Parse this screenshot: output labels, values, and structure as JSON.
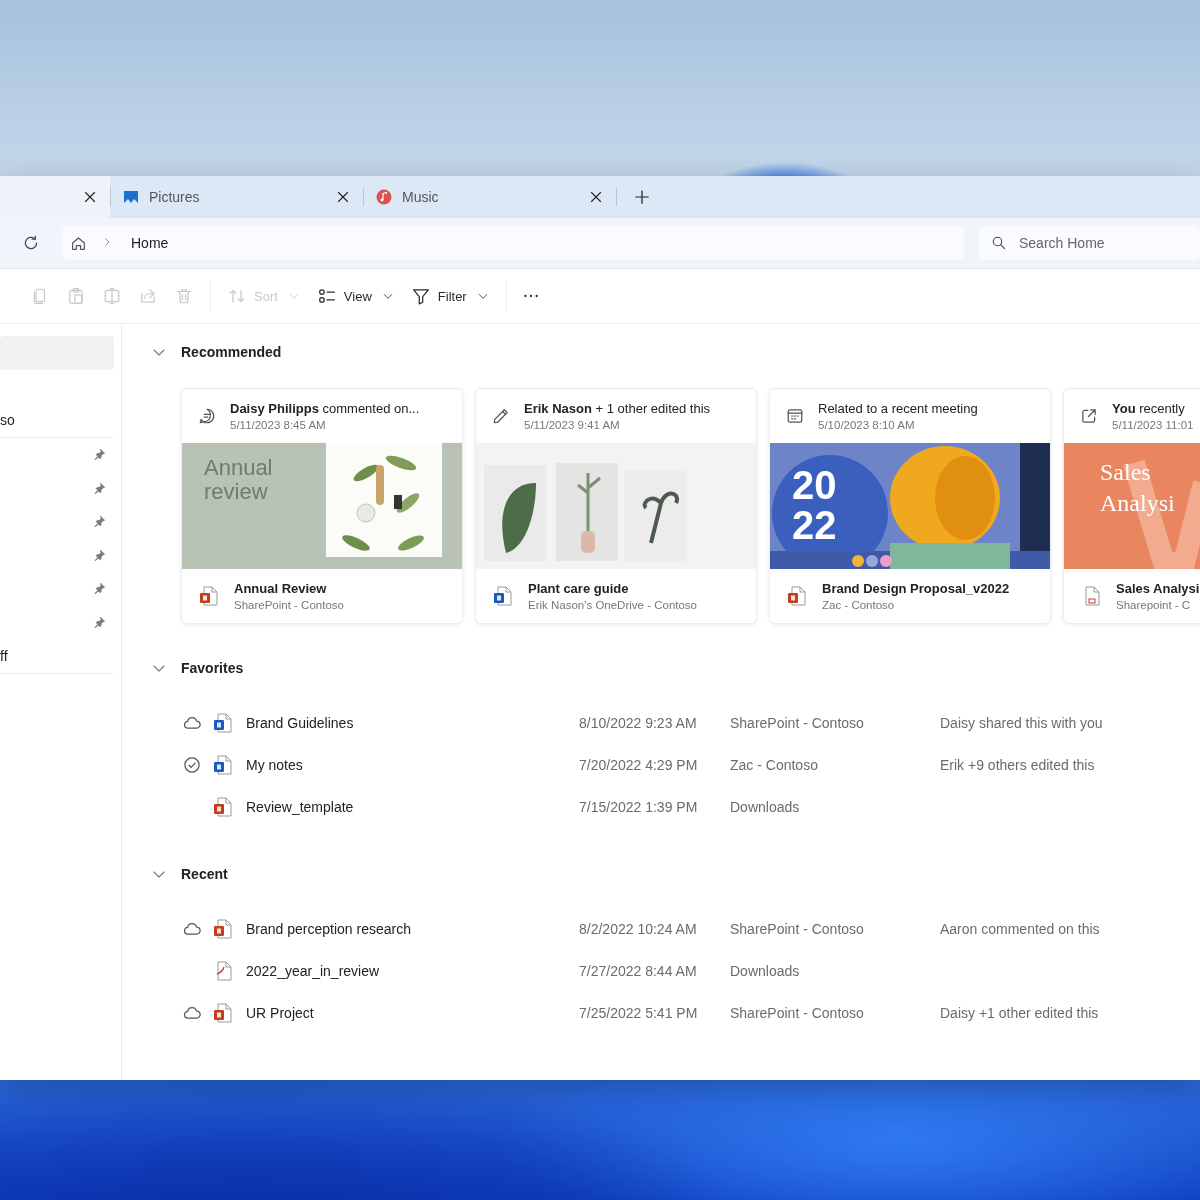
{
  "tabs": [
    {
      "selected": true
    },
    {
      "title": "Pictures",
      "selected": false
    },
    {
      "title": "Music",
      "selected": false
    }
  ],
  "address": {
    "breadcrumb": "Home"
  },
  "search": {
    "placeholder": "Search Home"
  },
  "toolbar": [
    {
      "kind": "icon",
      "disabled": true
    },
    {
      "kind": "icon",
      "disabled": true
    },
    {
      "kind": "icon",
      "disabled": true
    },
    {
      "kind": "icon",
      "disabled": true
    },
    {
      "kind": "icon",
      "disabled": true
    },
    {
      "kind": "menu",
      "label": "Sort",
      "disabled": true
    },
    {
      "kind": "menu",
      "label": "View",
      "disabled": false
    },
    {
      "kind": "menu",
      "label": "Filter",
      "disabled": false
    },
    {
      "kind": "icon",
      "disabled": false
    }
  ],
  "sidebar": {
    "groups": [
      {
        "items": [
          {
            "selected": true,
            "pinned": false
          },
          {
            "label": "so",
            "selected": false,
            "pinned": false
          }
        ]
      },
      {
        "items": [
          {
            "selected": false,
            "pinned": true
          },
          {
            "selected": false,
            "pinned": true
          },
          {
            "selected": false,
            "pinned": true
          },
          {
            "selected": false,
            "pinned": true
          },
          {
            "selected": false,
            "pinned": true
          },
          {
            "selected": false,
            "pinned": true
          },
          {
            "label": "ff",
            "selected": false,
            "pinned": false
          }
        ]
      }
    ]
  },
  "sections": [
    {
      "kind": "cards",
      "title": "Recommended",
      "expanded": true,
      "cards": [
        {
          "activity": "**Daisy Philipps** commented on...",
          "time": "5/11/2023 8:45 AM",
          "thumbnail_text": [
            "Annual",
            "review"
          ],
          "name": "Annual Review",
          "location": "SharePoint - Contoso"
        },
        {
          "activity": "**Erik Nason** + 1 other edited this",
          "time": "5/11/2023 9:41 AM",
          "name": "Plant care guide",
          "location": "Erik Nason's OneDrive - Contoso"
        },
        {
          "activity": "Related to a recent meeting",
          "time": "5/10/2023 8:10 AM",
          "thumbnail_text": [
            "20",
            "22"
          ],
          "name": "Brand Design Proposal_v2022",
          "location": "Zac - Contoso"
        },
        {
          "activity": "**You** recently",
          "time": "5/11/2023 11:01",
          "thumbnail_text": [
            "Sales",
            "Analysi"
          ],
          "name": "Sales Analysi",
          "location": "Sharepoint - C"
        }
      ]
    },
    {
      "kind": "list",
      "title": "Favorites",
      "expanded": true,
      "rows": [
        {
          "kind": "word",
          "cloud": true,
          "synced": false,
          "name": "Brand Guidelines",
          "date": "8/10/2022 9:23 AM",
          "location": "SharePoint - Contoso",
          "activity": "Daisy shared this with you"
        },
        {
          "kind": "word",
          "cloud": false,
          "synced": true,
          "name": "My notes",
          "date": "7/20/2022 4:29 PM",
          "location": "Zac - Contoso",
          "activity": "Erik +9 others edited this"
        },
        {
          "kind": "ppt",
          "cloud": false,
          "synced": false,
          "name": "Review_template",
          "date": "7/15/2022 1:39 PM",
          "location": "Downloads"
        }
      ]
    },
    {
      "kind": "list",
      "title": "Recent",
      "expanded": true,
      "rows": [
        {
          "kind": "ppt",
          "cloud": true,
          "synced": false,
          "name": "Brand perception research",
          "date": "8/2/2022 10:24 AM",
          "location": "SharePoint - Contoso",
          "activity": "Aaron commented on this"
        },
        {
          "kind": "pdf",
          "cloud": false,
          "synced": false,
          "name": "2022_year_in_review",
          "date": "7/27/2022 8:44 AM",
          "location": "Downloads"
        },
        {
          "kind": "ppt",
          "cloud": true,
          "synced": false,
          "name": "UR Project",
          "date": "7/25/2022 5:41 PM",
          "location": "SharePoint - Contoso",
          "activity": "Daisy +1 other edited this"
        }
      ]
    }
  ]
}
